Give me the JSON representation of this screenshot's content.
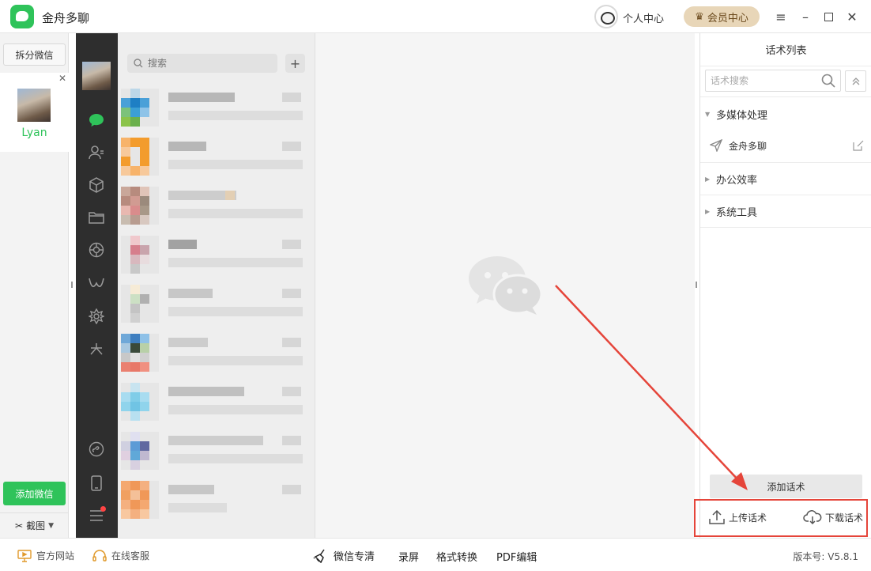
{
  "app": {
    "title": "金舟多聊"
  },
  "header": {
    "personal_center": "个人中心",
    "vip_center": "会员中心"
  },
  "accounts": {
    "split_button": "拆分微信",
    "items": [
      {
        "name": "Lyan"
      }
    ],
    "add_button": "添加微信",
    "screenshot_button": "截图"
  },
  "chatlist": {
    "search_placeholder": "搜索"
  },
  "scripts_panel": {
    "title": "话术列表",
    "search_placeholder": "话术搜索",
    "groups": [
      {
        "name": "多媒体处理",
        "expanded": true,
        "items": [
          {
            "name": "金舟多聊"
          }
        ]
      },
      {
        "name": "办公效率",
        "expanded": false
      },
      {
        "name": "系统工具",
        "expanded": false
      }
    ],
    "add_button": "添加话术",
    "upload_button": "上传话术",
    "download_button": "下载话术"
  },
  "footer": {
    "official_site": "官方网站",
    "online_service": "在线客服",
    "tools": [
      "微信专清",
      "录屏",
      "格式转换",
      "PDF编辑"
    ],
    "version_label": "版本号: V5.8.1"
  },
  "colors": {
    "brand_green": "#2fc35a",
    "highlight_red": "#e5453a",
    "vip_gold": "#e8d6b8"
  }
}
